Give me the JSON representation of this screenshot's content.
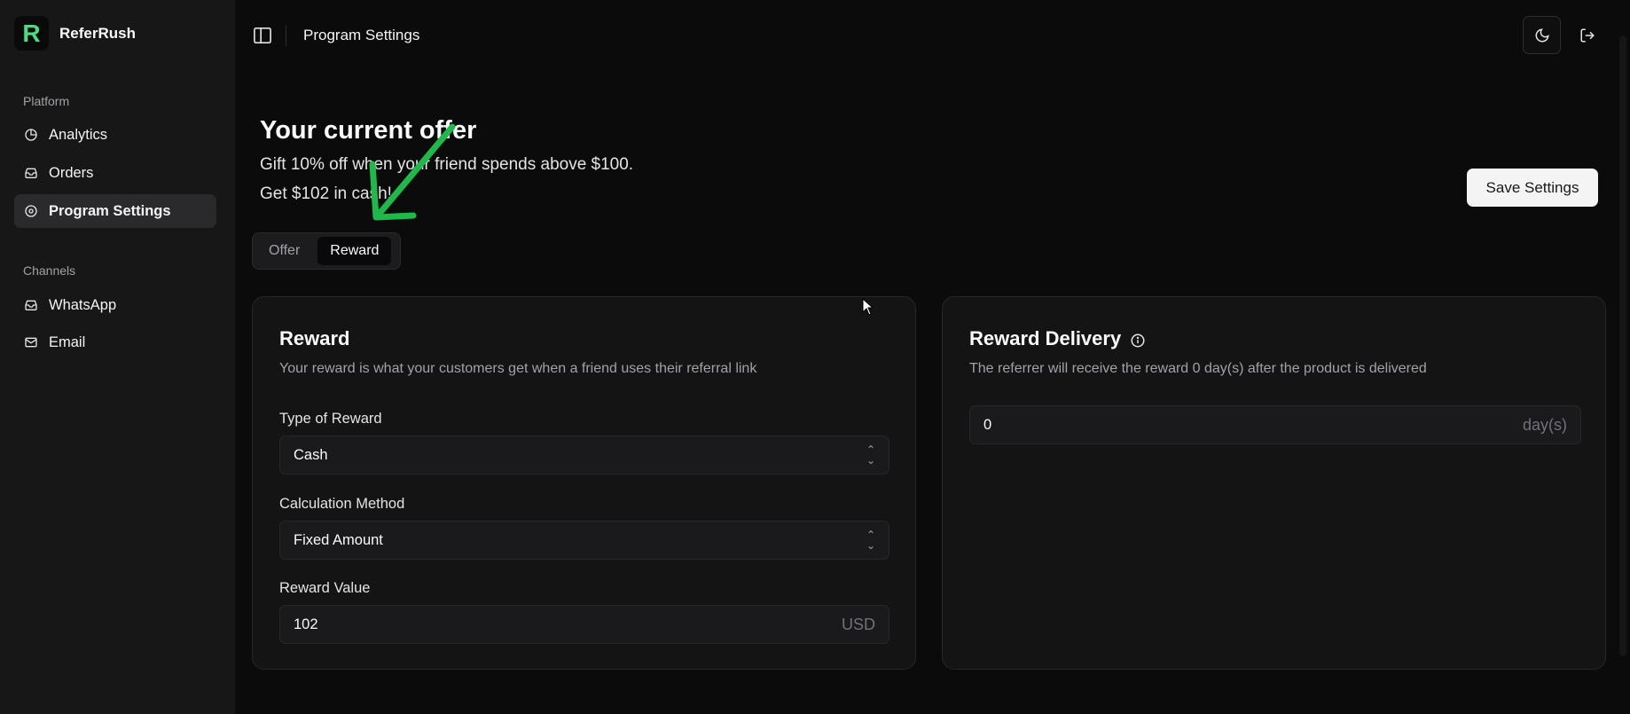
{
  "app": {
    "name": "ReferRush",
    "logo_letter": "R"
  },
  "sidebar": {
    "groups": [
      {
        "label": "Platform",
        "items": [
          {
            "label": "Analytics",
            "icon": "pie-chart-icon"
          },
          {
            "label": "Orders",
            "icon": "inbox-icon"
          },
          {
            "label": "Program Settings",
            "icon": "settings-icon",
            "active": true
          }
        ]
      },
      {
        "label": "Channels",
        "items": [
          {
            "label": "WhatsApp",
            "icon": "inbox-icon"
          },
          {
            "label": "Email",
            "icon": "mail-icon"
          }
        ]
      }
    ]
  },
  "header": {
    "title": "Program Settings"
  },
  "offer": {
    "title": "Your current offer",
    "line1": "Gift 10% off when your friend spends above $100.",
    "line2": "Get $102 in cash!"
  },
  "actions": {
    "save_label": "Save Settings"
  },
  "tabs": [
    {
      "label": "Offer",
      "active": false
    },
    {
      "label": "Reward",
      "active": true
    }
  ],
  "reward_card": {
    "title": "Reward",
    "description": "Your reward is what your customers get when a friend uses their referral link",
    "type_label": "Type of Reward",
    "type_value": "Cash",
    "method_label": "Calculation Method",
    "method_value": "Fixed Amount",
    "value_label": "Reward Value",
    "value": "102",
    "value_suffix": "USD"
  },
  "delivery_card": {
    "title": "Reward Delivery",
    "description": "The referrer will receive the reward 0 day(s) after the product is delivered",
    "days_value": "0",
    "days_suffix": "day(s)"
  },
  "colors": {
    "accent": "#4ade80",
    "annotation_arrow": "#1fb84a",
    "background": "#0b0b0c"
  }
}
